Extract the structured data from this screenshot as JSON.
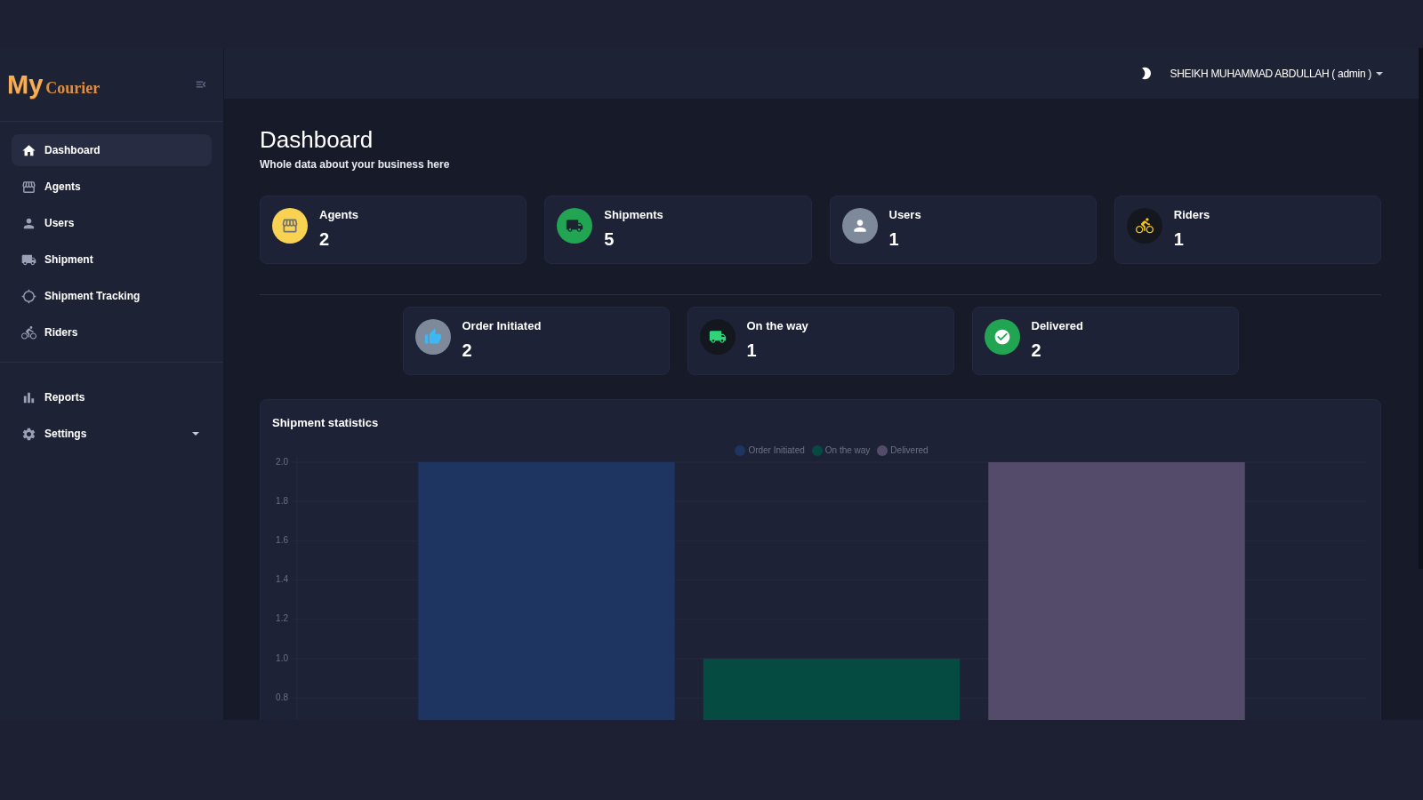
{
  "sidebar": {
    "logo": {
      "word_1": "My",
      "word_2": "Courier"
    },
    "nav_groups": [
      {
        "items": [
          {
            "label": "Dashboard",
            "selected": true
          },
          {
            "label": "Agents",
            "selected": false
          },
          {
            "label": "Users",
            "selected": false
          },
          {
            "label": "Shipment",
            "selected": false
          },
          {
            "label": "Shipment Tracking",
            "selected": false
          },
          {
            "label": "Riders",
            "selected": false
          }
        ]
      },
      {
        "items": [
          {
            "label": "Reports",
            "selected": false
          },
          {
            "label": "Settings",
            "selected": false,
            "expanded": false
          }
        ]
      }
    ]
  },
  "header": {
    "user_name": "SHEIKH MUHAMMAD ABDULLAH ( admin )"
  },
  "page": {
    "title": "Dashboard",
    "subtitle": "Whole data about your business here"
  },
  "summary_cards": [
    {
      "label": "Agents",
      "value": "2"
    },
    {
      "label": "Shipments",
      "value": "5"
    },
    {
      "label": "Users",
      "value": "1"
    },
    {
      "label": "Riders",
      "value": "1"
    }
  ],
  "status_cards": [
    {
      "label": "Order Initiated",
      "value": "2"
    },
    {
      "label": "On the way",
      "value": "1"
    },
    {
      "label": "Delivered",
      "value": "2"
    }
  ],
  "shipment_statistics": {
    "title": "Shipment statistics",
    "chart_data": {
      "type": "bar",
      "legend": "top",
      "series": [
        {
          "name": "Order Initiated",
          "color": "#1e3461",
          "values": [
            2
          ]
        },
        {
          "name": "On the way",
          "color": "#054b42",
          "values": [
            1
          ]
        },
        {
          "name": "Delivered",
          "color": "#544b6b",
          "values": [
            2
          ]
        }
      ],
      "ylim": [
        0.66,
        2
      ],
      "yticks": [
        {
          "value": 0.8,
          "label": "0.8"
        },
        {
          "value": 1,
          "label": "1.0"
        },
        {
          "value": 1.2,
          "label": "1.2"
        },
        {
          "value": 1.4,
          "label": "1.4"
        },
        {
          "value": 1.6,
          "label": "1.6"
        },
        {
          "value": 1.8,
          "label": "1.8"
        },
        {
          "value": 2,
          "label": "2.0"
        }
      ]
    }
  }
}
